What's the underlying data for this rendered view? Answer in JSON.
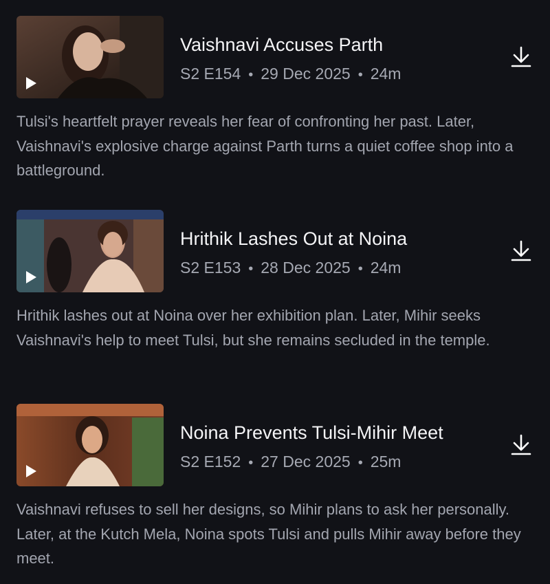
{
  "episodes": [
    {
      "title": "Vaishnavi Accuses Parth",
      "season_episode": "S2 E154",
      "date": "29 Dec 2025",
      "duration": "24m",
      "description": "Tulsi's heartfelt prayer reveals her fear of confronting her past. Later, Vaishnavi's explosive charge against Parth turns a quiet coffee shop into a battleground.",
      "thumbnail_colors": [
        "#3a2a24",
        "#d9b8a3",
        "#1a1410"
      ]
    },
    {
      "title": "Hrithik Lashes Out at Noina",
      "season_episode": "S2 E153",
      "date": "28 Dec 2025",
      "duration": "24m",
      "description": "Hrithik lashes out at Noina over her exhibition plan. Later, Mihir seeks Vaishnavi's help to meet Tulsi, but she remains secluded in the temple.",
      "thumbnail_colors": [
        "#5a3b38",
        "#c89a84",
        "#2c3f48"
      ]
    },
    {
      "title": "Noina Prevents Tulsi-Mihir Meet",
      "season_episode": "S2 E152",
      "date": "27 Dec 2025",
      "duration": "25m",
      "description": "Vaishnavi refuses to sell her designs, so Mihir plans to ask her personally. Later, at the Kutch Mela, Noina spots Tulsi and pulls Mihir away before they meet.",
      "thumbnail_colors": [
        "#6b3a22",
        "#d7a27c",
        "#2a1a12"
      ]
    }
  ],
  "separator": "•",
  "icons": {
    "play": "play-icon",
    "download": "download-icon"
  },
  "colors": {
    "background": "#111217",
    "title": "#f4f4f6",
    "secondary_text": "#a6a9b3"
  }
}
